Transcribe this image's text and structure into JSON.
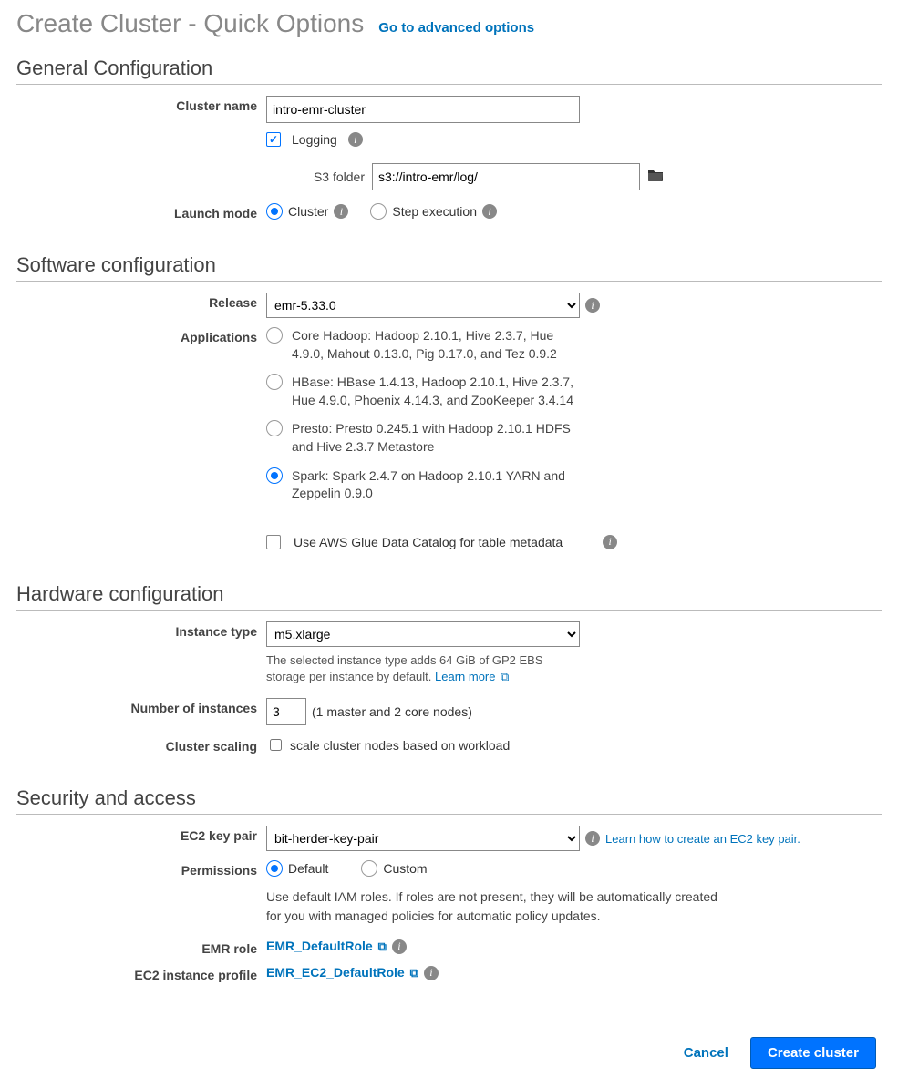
{
  "header": {
    "title": "Create Cluster - Quick Options",
    "advanced_link": "Go to advanced options"
  },
  "general": {
    "title": "General Configuration",
    "cluster_name_label": "Cluster name",
    "cluster_name_value": "intro-emr-cluster",
    "logging_label": "Logging",
    "s3_folder_label": "S3 folder",
    "s3_folder_value": "s3://intro-emr/log/",
    "launch_mode_label": "Launch mode",
    "launch_mode_cluster": "Cluster",
    "launch_mode_step": "Step execution"
  },
  "software": {
    "title": "Software configuration",
    "release_label": "Release",
    "release_value": "emr-5.33.0",
    "applications_label": "Applications",
    "app_core": "Core Hadoop: Hadoop 2.10.1, Hive 2.3.7, Hue 4.9.0, Mahout 0.13.0, Pig 0.17.0, and Tez 0.9.2",
    "app_hbase": "HBase: HBase 1.4.13, Hadoop 2.10.1, Hive 2.3.7, Hue 4.9.0, Phoenix 4.14.3, and ZooKeeper 3.4.14",
    "app_presto": "Presto: Presto 0.245.1 with Hadoop 2.10.1 HDFS and Hive 2.3.7 Metastore",
    "app_spark": "Spark: Spark 2.4.7 on Hadoop 2.10.1 YARN and Zeppelin 0.9.0",
    "glue_label": "Use AWS Glue Data Catalog for table metadata"
  },
  "hardware": {
    "title": "Hardware configuration",
    "instance_type_label": "Instance type",
    "instance_type_value": "m5.xlarge",
    "instance_hint_1": "The selected instance type adds 64 GiB of GP2 EBS storage per instance by default. ",
    "instance_hint_learn": "Learn more",
    "num_instances_label": "Number of instances",
    "num_instances_value": "3",
    "num_instances_desc": "(1 master and 2 core nodes)",
    "scaling_label": "Cluster scaling",
    "scaling_option": "scale cluster nodes based on workload"
  },
  "security": {
    "title": "Security and access",
    "key_pair_label": "EC2 key pair",
    "key_pair_value": "bit-herder-key-pair",
    "key_pair_hint": "Learn how to create an EC2 key pair.",
    "permissions_label": "Permissions",
    "perm_default": "Default",
    "perm_custom": "Custom",
    "perm_desc": "Use default IAM roles. If roles are not present, they will be automatically created for you with managed policies for automatic policy updates.",
    "emr_role_label": "EMR role",
    "emr_role_value": "EMR_DefaultRole",
    "ec2_profile_label": "EC2 instance profile",
    "ec2_profile_value": "EMR_EC2_DefaultRole"
  },
  "footer": {
    "cancel": "Cancel",
    "create": "Create cluster"
  }
}
